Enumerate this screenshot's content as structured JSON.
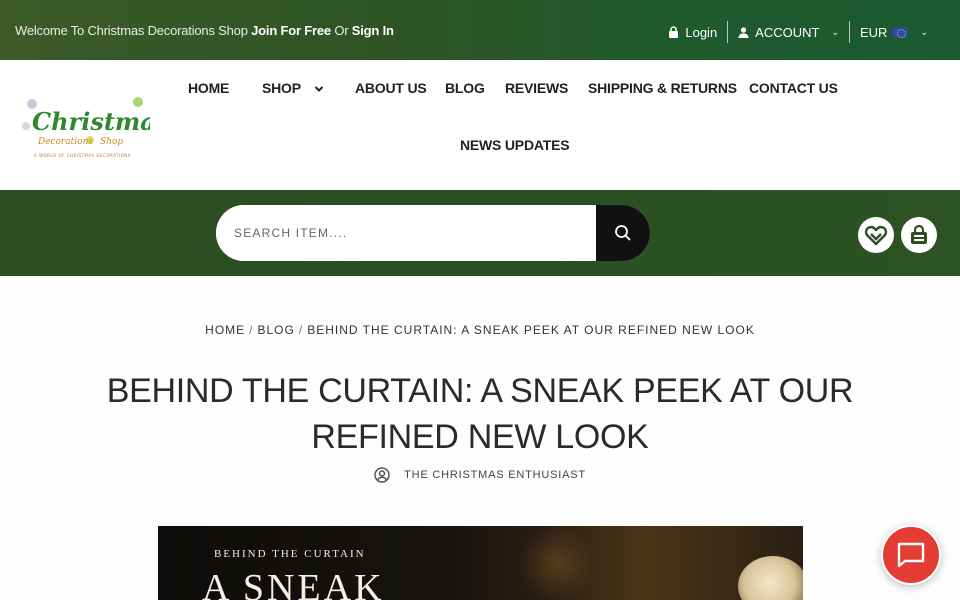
{
  "topbar": {
    "welcome_text": "Welcome To Christmas Decorations Shop",
    "join_label": "Join For Free",
    "or_text": "Or",
    "signin_label": "Sign In",
    "login_label": "Login",
    "account_label": "ACCOUNT",
    "currency_label": "EUR"
  },
  "logo": {
    "title": "Christmas",
    "subtitle": "Decorations Shop",
    "tagline": "A WORLD OF CHRISTMAS DECORATIONS"
  },
  "nav": {
    "items": [
      {
        "label": "HOME"
      },
      {
        "label": "SHOP"
      },
      {
        "label": "ABOUT US"
      },
      {
        "label": "BLOG"
      },
      {
        "label": "REVIEWS"
      },
      {
        "label": "SHIPPING & RETURNS"
      },
      {
        "label": "CONTACT US"
      },
      {
        "label": "NEWS UPDATES"
      }
    ]
  },
  "search": {
    "placeholder": "SEARCH ITEM...."
  },
  "breadcrumb": {
    "home": "HOME",
    "blog": "BLOG",
    "current": "BEHIND THE CURTAIN: A SNEAK PEEK AT OUR REFINED NEW LOOK"
  },
  "article": {
    "title": "BEHIND THE CURTAIN: A SNEAK PEEK AT OUR REFINED NEW LOOK",
    "author": "THE CHRISTMAS ENTHUSIAST"
  },
  "hero": {
    "subtitle": "BEHIND THE CURTAIN",
    "headline": "A SNEAK"
  },
  "colors": {
    "brand_green": "#2c4e22",
    "chat_red": "#e23c34"
  }
}
